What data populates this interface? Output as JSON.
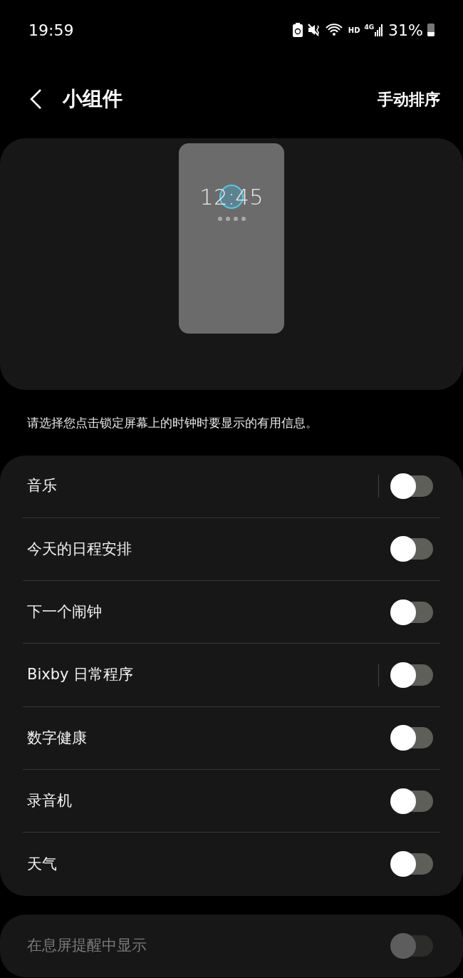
{
  "status_bar": {
    "time": "19:59",
    "network": "HD",
    "signal_type": "4G",
    "battery": "31%"
  },
  "header": {
    "title": "小组件",
    "action": "手动排序"
  },
  "preview": {
    "clock": "12:45"
  },
  "description": "请选择您点击锁定屏幕上的时钟时要显示的有用信息。",
  "widgets": [
    {
      "label": "音乐",
      "on": false,
      "divider": true
    },
    {
      "label": "今天的日程安排",
      "on": false,
      "divider": false
    },
    {
      "label": "下一个闹钟",
      "on": false,
      "divider": false
    },
    {
      "label": "Bixby 日常程序",
      "on": false,
      "divider": true
    },
    {
      "label": "数字健康",
      "on": false,
      "divider": false
    },
    {
      "label": "录音机",
      "on": false,
      "divider": false
    },
    {
      "label": "天气",
      "on": false,
      "divider": false
    }
  ],
  "aod_setting": {
    "label": "在息屏提醒中显示",
    "on": false,
    "disabled": true
  }
}
